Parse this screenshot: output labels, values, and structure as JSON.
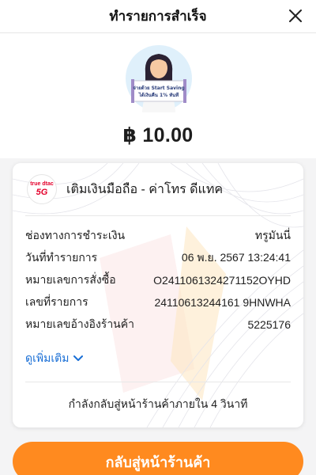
{
  "header": {
    "title": "ทำรายการสำเร็จ"
  },
  "hero": {
    "banner_line1": "จ่ายด้วย Start Saving",
    "banner_line2": "ได้เงินคืน 1% ทันที",
    "amount": "฿ 10.00"
  },
  "merchant": {
    "logo_line1": "true dtac",
    "logo_line2": "5G",
    "name": "เติมเงินมือถือ - ค่าโทร ดีแทค"
  },
  "details": [
    {
      "label": "ช่องทางการชำระเงิน",
      "value": "ทรูมันนี่"
    },
    {
      "label": "วันที่ทำรายการ",
      "value": "06 พ.ย. 2567 13:24:41"
    },
    {
      "label": "หมายเลขการสั่งซื้อ",
      "value": "O2411061324271152OYHD"
    },
    {
      "label": "เลขที่รายการ",
      "value": "24110613244161 9HNWHA"
    },
    {
      "label": "หมายเลขอ้างอิงร้านค้า",
      "value": "5225176"
    }
  ],
  "more_label": "ดูเพิ่มเติม",
  "countdown": "กำลังกลับสู่หน้าร้านค้าภายใน 4 วินาที",
  "cta_label": "กลับสู่หน้าร้านค้า",
  "colors": {
    "accent": "#ff8a1f",
    "link": "#1a6fd6",
    "brand_red": "#e4002b"
  },
  "icons": {
    "close": "close-icon",
    "chevron": "chevron-down-icon"
  }
}
